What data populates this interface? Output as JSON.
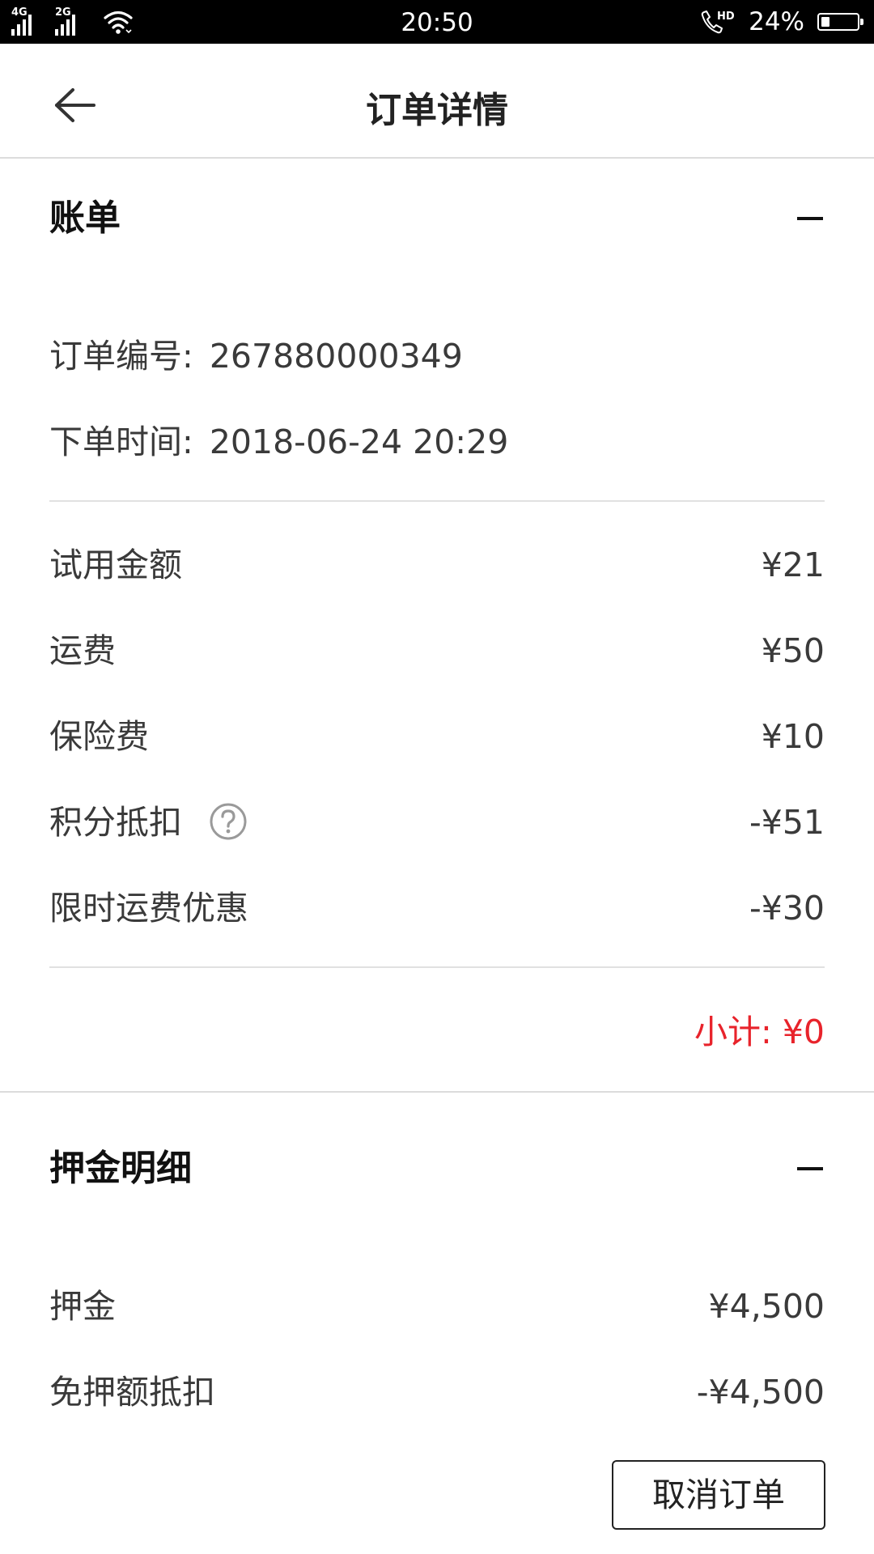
{
  "status_bar": {
    "signal_1_label": "4G",
    "signal_2_label": "2G",
    "time": "20:50",
    "hd_label": "HD",
    "battery_text": "24%",
    "battery_level": 0.24,
    "icons": [
      "signal-icon",
      "wifi-icon",
      "call-icon",
      "battery-icon"
    ]
  },
  "header": {
    "title": "订单详情",
    "back_icon": "back-arrow-icon"
  },
  "bill": {
    "title": "账单",
    "collapse_icon": "minus-icon",
    "order_number_label": "订单编号:",
    "order_number": "267880000349",
    "order_time_label": "下单时间:",
    "order_time": "2018-06-24 20:29",
    "items": [
      {
        "label": "试用金额",
        "value": "¥21"
      },
      {
        "label": "运费",
        "value": "¥50"
      },
      {
        "label": "保险费",
        "value": "¥10"
      },
      {
        "label": "积分抵扣",
        "value": "-¥51",
        "help_icon": "question-circle-icon"
      },
      {
        "label": "限时运费优惠",
        "value": "-¥30"
      }
    ],
    "subtotal": "小计: ¥0"
  },
  "deposit": {
    "title": "押金明细",
    "collapse_icon": "minus-icon",
    "items": [
      {
        "label": "押金",
        "value": "¥4,500"
      },
      {
        "label": "免押额抵扣",
        "value": "-¥4,500"
      }
    ]
  },
  "actions": {
    "cancel_label": "取消订单"
  },
  "colors": {
    "status_bar_bg": "#000000",
    "text": "#3a3a3a",
    "title_text": "#222222",
    "subtotal_red": "#e8232b",
    "divider": "#e1e1e1"
  }
}
